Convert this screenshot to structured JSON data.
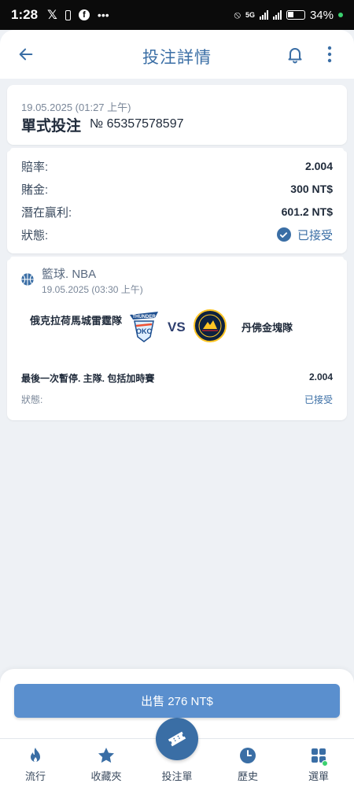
{
  "status_bar": {
    "time": "1:28",
    "battery": "34%",
    "network_label": "5G"
  },
  "header": {
    "title": "投注詳情"
  },
  "bet": {
    "date": "19.05.2025 (01:27 上午)",
    "type": "單式投注",
    "number": "№ 65357578597"
  },
  "summary": {
    "odds_label": "賠率:",
    "odds_value": "2.004",
    "stake_label": "賭金:",
    "stake_value": "300 NT$",
    "potential_label": "潛在贏利:",
    "potential_value": "601.2 NT$",
    "status_label": "狀態:",
    "status_value": "已接受"
  },
  "event": {
    "sport_league": "籃球. NBA",
    "date": "19.05.2025 (03:30 上午)",
    "home_team": "俄克拉荷馬城雷霆隊",
    "vs": "VS",
    "away_team": "丹佛金塊隊",
    "market": "最後一次暫停. 主隊. 包括加時賽",
    "market_odds": "2.004",
    "status_label": "狀態:",
    "status_value": "已接受"
  },
  "sell_button": {
    "label": "出售 276 NT$"
  },
  "nav": {
    "items": [
      {
        "label": "流行",
        "icon": "flame-icon"
      },
      {
        "label": "收藏夾",
        "icon": "star-icon"
      },
      {
        "label": "投注單",
        "icon": "ticket-icon"
      },
      {
        "label": "歷史",
        "icon": "clock-icon"
      },
      {
        "label": "選單",
        "icon": "grid-icon"
      }
    ]
  },
  "colors": {
    "accent": "#3a6ea5",
    "button": "#5a8fce",
    "background": "#eef1f5"
  }
}
